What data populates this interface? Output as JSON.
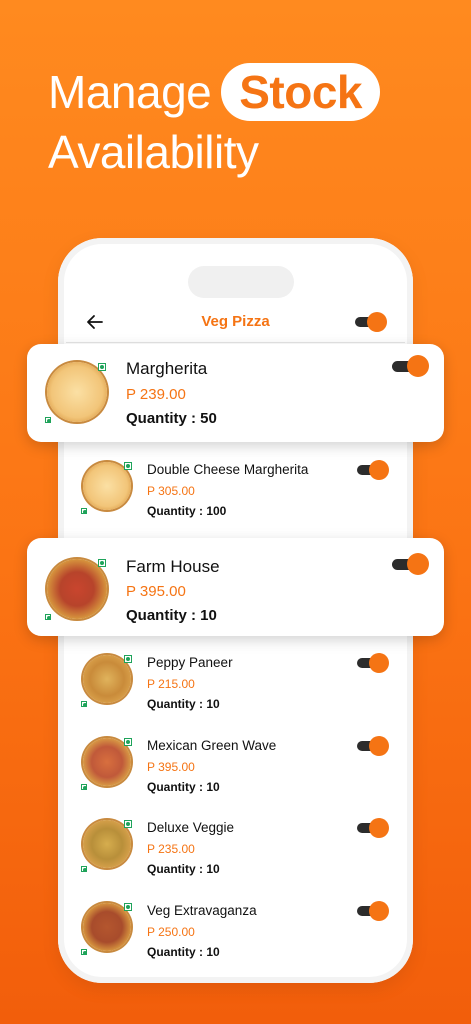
{
  "headline": {
    "line1": "Manage",
    "highlight": "Stock",
    "line2": "Availability"
  },
  "app": {
    "title": "Veg Pizza"
  },
  "featured": [
    {
      "name": "Margherita",
      "price": "P 239.00",
      "quantity": "Quantity : 50"
    },
    {
      "name": "Farm House",
      "price": "P 395.00",
      "quantity": "Quantity : 10"
    }
  ],
  "items": [
    {
      "name": "Double Cheese Margherita",
      "price": "P 305.00",
      "quantity": "Quantity : 100"
    },
    {
      "name": "Peppy Paneer",
      "price": "P 215.00",
      "quantity": "Quantity : 10"
    },
    {
      "name": "Mexican Green Wave",
      "price": "P 395.00",
      "quantity": "Quantity : 10"
    },
    {
      "name": "Deluxe Veggie",
      "price": "P 235.00",
      "quantity": "Quantity : 10"
    },
    {
      "name": "Veg Extravaganza",
      "price": "P 250.00",
      "quantity": "Quantity : 10"
    }
  ],
  "colors": {
    "accent": "#f57414",
    "veg": "#1ea35a",
    "toggle_track": "#2c2c2c"
  },
  "icons": {
    "back": "arrow-left-icon",
    "veg": "veg-mark-icon"
  }
}
